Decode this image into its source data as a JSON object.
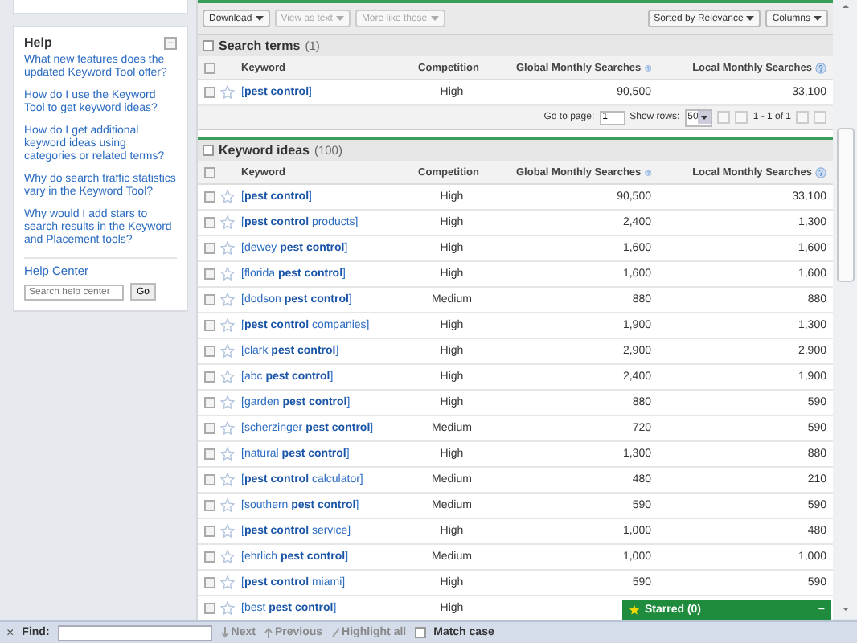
{
  "help": {
    "title": "Help",
    "collapse": "−",
    "links": [
      "What new features does the updated Keyword Tool offer?",
      "How do I use the Keyword Tool to get keyword ideas?",
      "How do I get additional keyword ideas using categories or related terms?",
      "Why do search traffic statistics vary in the Keyword Tool?",
      "Why would I add stars to search results in the Keyword and Placement tools?"
    ],
    "center": "Help Center",
    "search": {
      "placeholder": "Search help center"
    },
    "go": "Go"
  },
  "toolbar": {
    "left": [
      {
        "label": "Download",
        "disabled": false
      },
      {
        "label": "View as text",
        "disabled": true
      },
      {
        "label": "More like these",
        "disabled": true
      }
    ],
    "right": [
      {
        "label": "Sorted by Relevance",
        "disabled": false
      },
      {
        "label": "Columns",
        "disabled": false
      }
    ]
  },
  "search_terms": {
    "title": "Search terms",
    "count": "(1)",
    "all_checked": false,
    "columns": [
      {
        "label": "Keyword",
        "kind": "plain"
      },
      {
        "label": "Competition",
        "kind": "plain"
      },
      {
        "label": "Global Monthly Searches",
        "kind": "help"
      },
      {
        "label": "Local Monthly Searches",
        "kind": "help"
      }
    ],
    "rows": [
      {
        "keyword": "[**pest control**]",
        "competition": "High",
        "global": "90,500",
        "local": "33,100",
        "checked": false,
        "starred": false
      }
    ],
    "pager": {
      "go_label": "Go to page:",
      "page": "1",
      "rows_label": "Show rows:",
      "rows_value": "50",
      "range": "1 - 1 of 1"
    }
  },
  "keyword_ideas": {
    "title": "Keyword ideas",
    "count": "(100)",
    "all_checked": false,
    "columns": [
      {
        "label": "Keyword",
        "kind": "plain"
      },
      {
        "label": "Competition",
        "kind": "plain"
      },
      {
        "label": "Global Monthly Searches",
        "kind": "help"
      },
      {
        "label": "Local Monthly Searches",
        "kind": "help"
      }
    ],
    "rows": [
      {
        "keyword": "[**pest control**]",
        "competition": "High",
        "global": "90,500",
        "local": "33,100",
        "checked": false,
        "starred": false
      },
      {
        "keyword": "[**pest control** products]",
        "competition": "High",
        "global": "2,400",
        "local": "1,300",
        "checked": false,
        "starred": false
      },
      {
        "keyword": "[dewey **pest control**]",
        "competition": "High",
        "global": "1,600",
        "local": "1,600",
        "checked": false,
        "starred": false
      },
      {
        "keyword": "[florida **pest control**]",
        "competition": "High",
        "global": "1,600",
        "local": "1,600",
        "checked": false,
        "starred": false
      },
      {
        "keyword": "[dodson **pest control**]",
        "competition": "Medium",
        "global": "880",
        "local": "880",
        "checked": false,
        "starred": false
      },
      {
        "keyword": "[**pest control** companies]",
        "competition": "High",
        "global": "1,900",
        "local": "1,300",
        "checked": false,
        "starred": false
      },
      {
        "keyword": "[clark **pest control**]",
        "competition": "High",
        "global": "2,900",
        "local": "2,900",
        "checked": false,
        "starred": false
      },
      {
        "keyword": "[abc **pest control**]",
        "competition": "High",
        "global": "2,400",
        "local": "1,900",
        "checked": false,
        "starred": false
      },
      {
        "keyword": "[garden **pest control**]",
        "competition": "High",
        "global": "880",
        "local": "590",
        "checked": false,
        "starred": false
      },
      {
        "keyword": "[scherzinger **pest control**]",
        "competition": "Medium",
        "global": "720",
        "local": "590",
        "checked": false,
        "starred": false
      },
      {
        "keyword": "[natural **pest control**]",
        "competition": "High",
        "global": "1,300",
        "local": "880",
        "checked": false,
        "starred": false
      },
      {
        "keyword": "[**pest control** calculator]",
        "competition": "Medium",
        "global": "480",
        "local": "210",
        "checked": false,
        "starred": false
      },
      {
        "keyword": "[southern **pest control**]",
        "competition": "Medium",
        "global": "590",
        "local": "590",
        "checked": false,
        "starred": false
      },
      {
        "keyword": "[**pest control** service]",
        "competition": "High",
        "global": "1,000",
        "local": "480",
        "checked": false,
        "starred": false
      },
      {
        "keyword": "[ehrlich **pest control**]",
        "competition": "Medium",
        "global": "1,000",
        "local": "1,000",
        "checked": false,
        "starred": false
      },
      {
        "keyword": "[**pest control** miami]",
        "competition": "High",
        "global": "590",
        "local": "590",
        "checked": false,
        "starred": false
      },
      {
        "keyword": "[best **pest control**]",
        "competition": "High",
        "checked": false,
        "starred": false
      }
    ]
  },
  "starred": {
    "label": "Starred (0)",
    "collapse": "−"
  },
  "find_bar": {
    "close": "×",
    "label": "Find:",
    "next": "Next",
    "previous": "Previous",
    "highlight": "Highlight all",
    "match_case": "Match case",
    "match_case_checked": false
  }
}
